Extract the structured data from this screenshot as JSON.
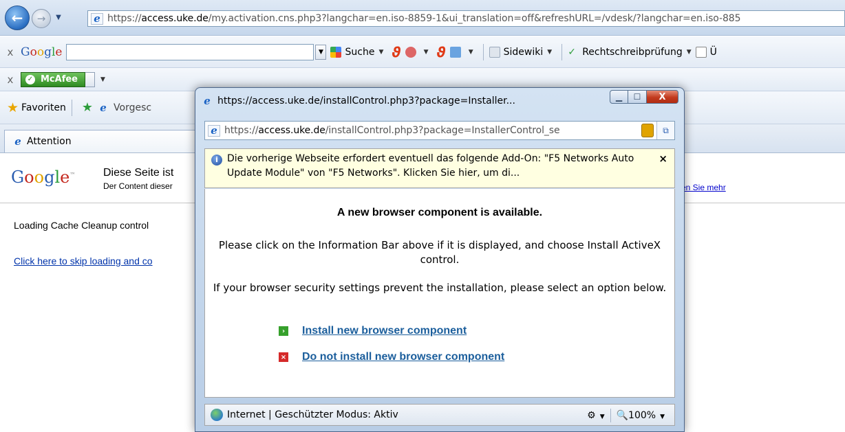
{
  "browser": {
    "address": {
      "prefix": "https://",
      "host": "access.uke.de",
      "path": "/my.activation.cns.php3?langchar=en.iso-8859-1&ui_translation=off&refreshURL=/vdesk/?langchar=en.iso-885"
    },
    "google_toolbar": {
      "logo": "Google",
      "suche_label": "Suche",
      "sidewiki_label": "Sidewiki",
      "spellcheck_label": "Rechtschreibprüfung",
      "translate_label": "Ü"
    },
    "mcafee_label": "McAfee",
    "favorites": {
      "label": "Favoriten",
      "suggested_label": "Vorgesc"
    },
    "tab_title": "Attention"
  },
  "page": {
    "banner": {
      "logo": "Google",
      "title": "Diese Seite ist",
      "subtitle": "Der Content dieser",
      "link": "en Sie mehr"
    },
    "loading_text": "Loading Cache Cleanup control",
    "skip_link": "Click here to skip loading and co"
  },
  "popup": {
    "window_title": "https://access.uke.de/installControl.php3?package=Installer...",
    "address": {
      "prefix": "https://",
      "host": "access.uke.de",
      "path": "/installControl.php3?package=InstallerControl_se"
    },
    "info_bar": {
      "text": "Die vorherige Webseite erfordert eventuell das folgende Add-On: \"F5 Networks Auto Update Module\" von \"F5 Networks\". Klicken Sie hier, um di...",
      "close": "×"
    },
    "heading": "A new browser component is available.",
    "paragraph1": "Please click on the Information Bar above if it is displayed, and choose Install ActiveX control.",
    "paragraph2": "If your browser security settings prevent the installation, please select an option below.",
    "option_install": "Install new browser component",
    "option_decline": "Do not install new browser component",
    "status": {
      "zone": "Internet | Geschützter Modus: Aktiv",
      "zoom": "100%"
    }
  }
}
